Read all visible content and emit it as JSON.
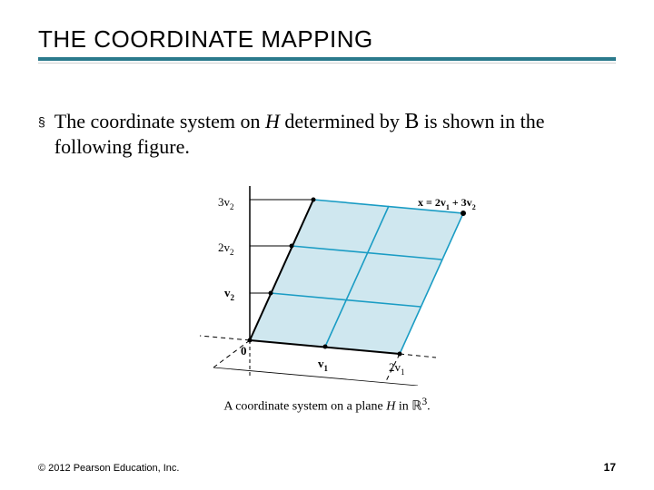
{
  "title": "THE COORDINATE MAPPING",
  "bullet": {
    "part1": "The coordinate system on ",
    "H": "H",
    "part2": " determined by ",
    "B": "B",
    "part3": " is shown in the following figure."
  },
  "figure": {
    "labels": {
      "origin": "0",
      "v1": "v",
      "v1_sub": "1",
      "two_v1": "2v",
      "two_v1_sub": "1",
      "v2": "v",
      "v2_sub": "2",
      "two_v2": "2v",
      "two_v2_sub": "2",
      "three_v2": "3v",
      "three_v2_sub": "2",
      "x_eq": "x = 2v",
      "x_eq_sub1": "1",
      "x_eq_mid": " + 3v",
      "x_eq_sub2": "2"
    },
    "caption_pre": "A coordinate system on a plane ",
    "caption_H": "H",
    "caption_mid": " in ",
    "caption_R": "ℝ",
    "caption_exp": "3",
    "caption_end": "."
  },
  "footer": {
    "copyright": "© 2012 Pearson Education, Inc.",
    "page": "17"
  },
  "chart_data": {
    "type": "diagram",
    "description": "3D oblique projection of a plane H in R^3 with a skewed coordinate grid determined by basis vectors v1 and v2. Marked ticks along v1-direction at v1 and 2v1; along v2-direction at v2, 2v2, 3v2. Point x = 2v1 + 3v2 highlighted on the grid.",
    "basis_ticks": {
      "v1_axis": [
        "v1",
        "2v1"
      ],
      "v2_axis": [
        "v2",
        "2v2",
        "3v2"
      ]
    },
    "marked_point": {
      "name": "x",
      "coords_in_basis": [
        2,
        3
      ]
    },
    "colors": {
      "plane_fill": "#cfe7ef",
      "grid": "#1a9cc4",
      "axes": "#000000"
    }
  }
}
